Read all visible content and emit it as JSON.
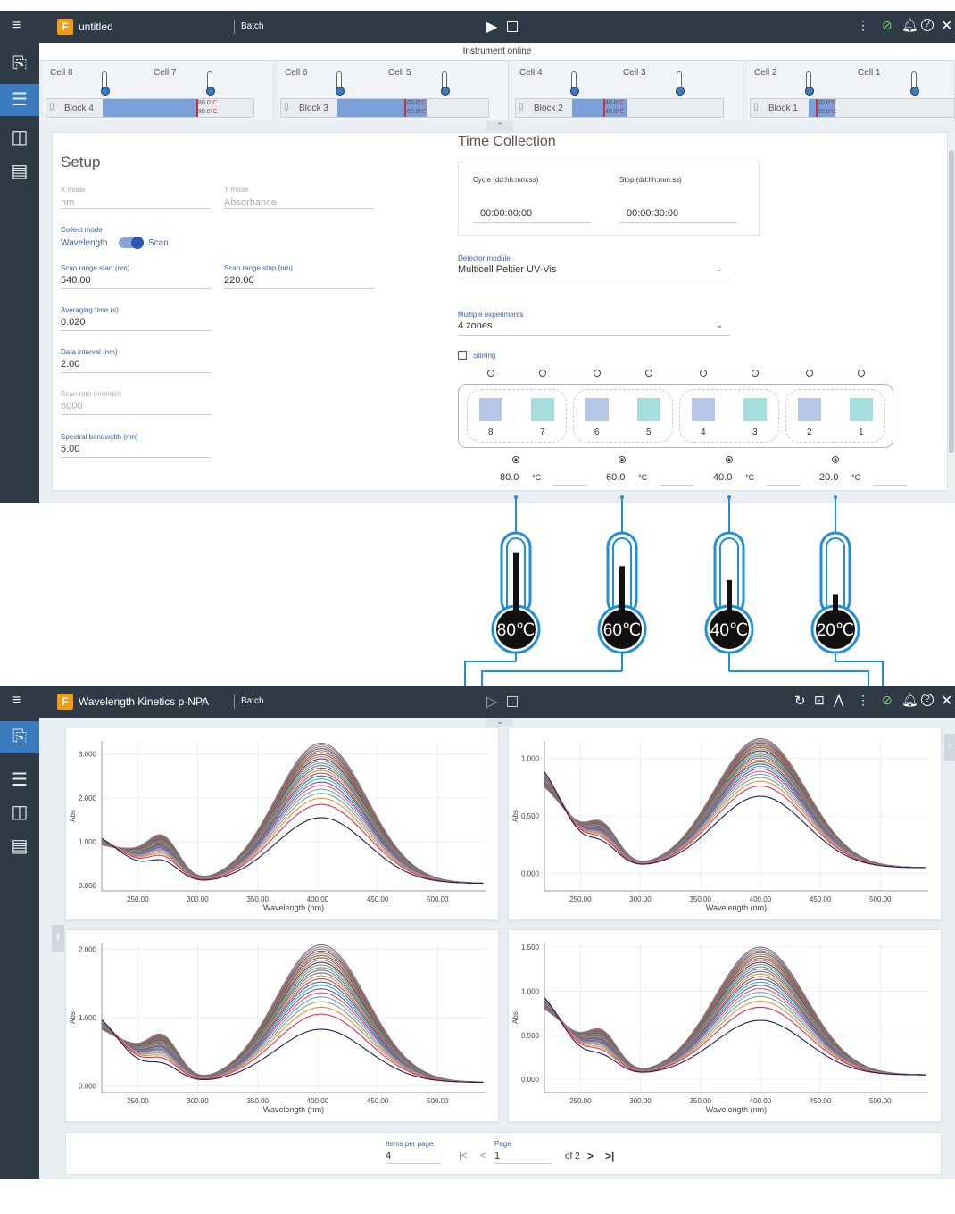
{
  "top_app": {
    "title": "untitled",
    "mode": "Batch",
    "status": "Instrument online"
  },
  "cells": [
    {
      "block": "Block 4",
      "cell_a": "Cell 8",
      "cell_b": "Cell 7",
      "temp_set": "80.0",
      "temp_act": "80.0",
      "unit": "°C"
    },
    {
      "block": "Block 3",
      "cell_a": "Cell 6",
      "cell_b": "Cell 5",
      "temp_set": "60.0",
      "temp_act": "60.0",
      "unit": "°C"
    },
    {
      "block": "Block 2",
      "cell_a": "Cell 4",
      "cell_b": "Cell 3",
      "temp_set": "40.0",
      "temp_act": "40.0",
      "unit": "°C"
    },
    {
      "block": "Block 1",
      "cell_a": "Cell 2",
      "cell_b": "Cell 1",
      "temp_set": "20.0",
      "temp_act": "20.0",
      "unit": "°C"
    }
  ],
  "setup": {
    "title": "Setup",
    "x_mode_label": "X mode",
    "x_mode": "nm",
    "y_mode_label": "Y mode",
    "y_mode": "Absorbance",
    "collect_mode_label": "Collect mode",
    "collect_left": "Wavelength",
    "collect_right": "Scan",
    "scan_start_label": "Scan range start (nm)",
    "scan_start": "540.00",
    "scan_stop_label": "Scan range stop (nm)",
    "scan_stop": "220.00",
    "avg_label": "Averaging time (s)",
    "avg": "0.020",
    "interval_label": "Data interval (nm)",
    "interval": "2.00",
    "rate_label": "Scan rate (nm/min)",
    "rate": "6000",
    "sbw_label": "Spectral bandwidth (nm)",
    "sbw": "5.00"
  },
  "time_collection": {
    "title": "Time Collection",
    "cycle_label": "Cycle (dd:hh:mm:ss)",
    "cycle": "00:00:00:00",
    "stop_label": "Stop (dd:hh:mm:ss)",
    "stop": "00:00:30:00",
    "detector_label": "Detector module",
    "detector": "Multicell Peltier UV-Vis",
    "multi_label": "Multiple experiments",
    "multi": "4 zones",
    "stirring": "Stirring",
    "cell_numbers": [
      "8",
      "7",
      "6",
      "5",
      "4",
      "3",
      "2",
      "1"
    ],
    "zone_temps": [
      "80.0",
      "60.0",
      "40.0",
      "20.0"
    ],
    "temp_unit": "°C"
  },
  "thermometers": [
    "80℃",
    "60℃",
    "40℃",
    "20℃"
  ],
  "thermometer_levels": [
    0.85,
    0.65,
    0.45,
    0.25
  ],
  "bottom_app": {
    "title": "Wavelength Kinetics p-NPA",
    "mode": "Batch"
  },
  "pagination": {
    "items_label": "Items per page",
    "items": "4",
    "page_label": "Page",
    "page": "1",
    "of": "of 2"
  },
  "colors": {
    "dark": "#2e3a45",
    "accent": "#3b7bbf",
    "green": "#6bd36b",
    "red": "#d32f2f"
  },
  "chart_data": [
    {
      "type": "line",
      "xlabel": "Wavelength (nm)",
      "ylabel": "Abs",
      "xlim": [
        220,
        540
      ],
      "ylim": [
        -0.12,
        3.3
      ],
      "xticks": [
        "250.00",
        "300.00",
        "350.00",
        "400.00",
        "450.00",
        "500.00"
      ],
      "yticks": [
        "0.000",
        "1.000",
        "2.000",
        "3.000"
      ],
      "peak_min": 1.5,
      "peak_max": 3.2,
      "peak_nm": 403,
      "shoulder_nm": 270,
      "base": 1.1
    },
    {
      "type": "line",
      "xlabel": "Wavelength (nm)",
      "ylabel": "Abs",
      "xlim": [
        220,
        540
      ],
      "ylim": [
        -0.15,
        1.15
      ],
      "xticks": [
        "250.00",
        "300.00",
        "350.00",
        "400.00",
        "450.00",
        "500.00"
      ],
      "yticks": [
        "0.000",
        "0.500",
        "1.000"
      ],
      "peak_min": 0.62,
      "peak_max": 1.12,
      "peak_nm": 400,
      "shoulder_nm": 267,
      "base": 0.9
    },
    {
      "type": "line",
      "xlabel": "Wavelength (nm)",
      "ylabel": "Abs",
      "xlim": [
        220,
        540
      ],
      "ylim": [
        -0.1,
        2.1
      ],
      "xticks": [
        "250.00",
        "300.00",
        "350.00",
        "400.00",
        "450.00",
        "500.00"
      ],
      "yticks": [
        "0.000",
        "1.000",
        "2.000"
      ],
      "peak_min": 0.78,
      "peak_max": 2.02,
      "peak_nm": 403,
      "shoulder_nm": 270,
      "base": 1.0
    },
    {
      "type": "line",
      "xlabel": "Wavelength (nm)",
      "ylabel": "Abs",
      "xlim": [
        220,
        540
      ],
      "ylim": [
        -0.15,
        1.55
      ],
      "xticks": [
        "250.00",
        "300.00",
        "350.00",
        "400.00",
        "450.00",
        "500.00"
      ],
      "yticks": [
        "0.000",
        "0.500",
        "1.000",
        "1.500"
      ],
      "peak_min": 0.62,
      "peak_max": 1.45,
      "peak_nm": 400,
      "shoulder_nm": 267,
      "base": 0.95
    }
  ]
}
